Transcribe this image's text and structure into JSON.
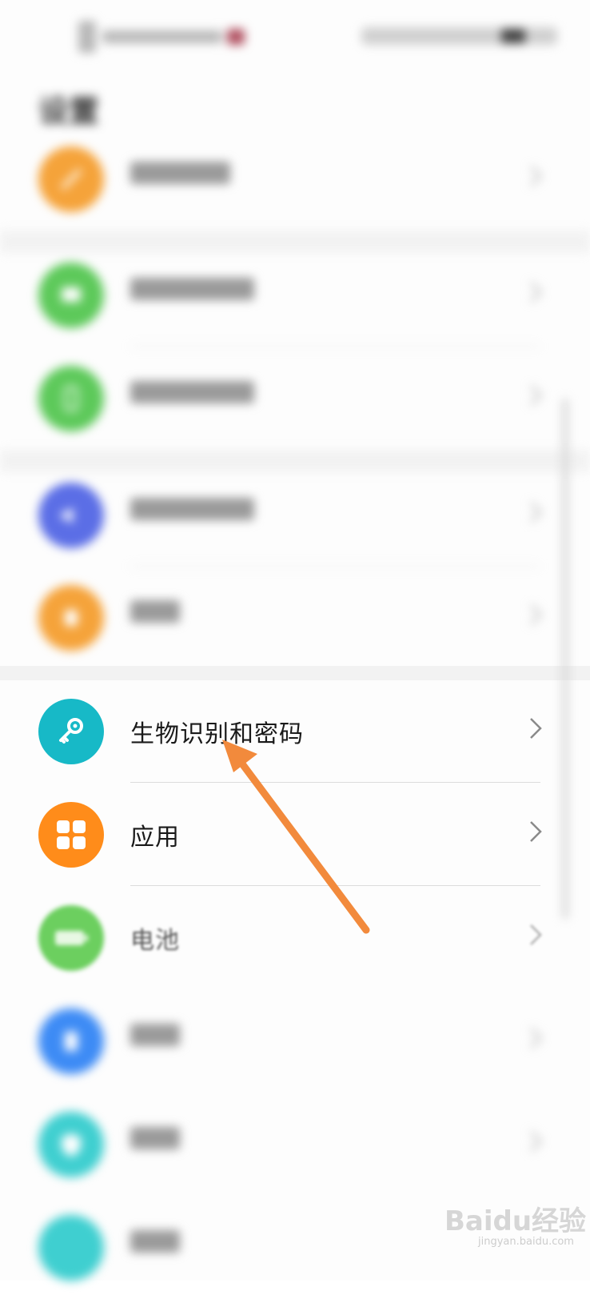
{
  "colors": {
    "orange": "#f5a33a",
    "green": "#5dc95a",
    "blue_purple": "#5b6ee6",
    "teal": "#17b9c7",
    "app_orange": "#ff8c1a",
    "battery_green": "#6ccf5f",
    "blue": "#3d8bf5",
    "cyan": "#3fcfd0",
    "arrow": "#f28a3c"
  },
  "status_bar": {
    "battery_icon": "battery-icon"
  },
  "header": {
    "title": "设置"
  },
  "rows": [
    {
      "label": "",
      "icon": "link-icon",
      "blurred": true
    },
    {
      "label": "",
      "icon": "desktop-icon",
      "blurred": true
    },
    {
      "label": "",
      "icon": "display-icon",
      "blurred": true
    },
    {
      "label": "",
      "icon": "sound-icon",
      "blurred": true
    },
    {
      "label": "",
      "icon": "notification-icon",
      "blurred": true
    },
    {
      "label": "生物识别和密码",
      "icon": "key-icon",
      "blurred": false
    },
    {
      "label": "应用",
      "icon": "apps-grid-icon",
      "blurred": false
    },
    {
      "label": "电池",
      "icon": "battery-icon",
      "blurred": true
    },
    {
      "label": "",
      "icon": "storage-icon",
      "blurred": true
    },
    {
      "label": "",
      "icon": "security-icon",
      "blurred": true
    },
    {
      "label": "",
      "icon": "privacy-icon",
      "blurred": true
    }
  ],
  "watermark": {
    "text": "Baidu经验",
    "sub": "jingyan.baidu.com"
  }
}
